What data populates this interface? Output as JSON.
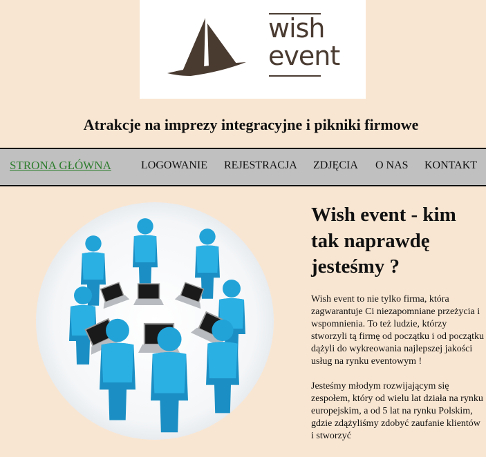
{
  "brand": {
    "logo_line1": "wish",
    "logo_line2": "event"
  },
  "tagline": "Atrakcje na imprezy integracyjne i pikniki firmowe",
  "nav": {
    "items": [
      {
        "label": "STRONA GŁÓWNA",
        "active": true
      },
      {
        "label": "LOGOWANIE",
        "active": false
      },
      {
        "label": "REJESTRACJA",
        "active": false
      },
      {
        "label": "ZDJĘCIA",
        "active": false
      },
      {
        "label": "O NAS",
        "active": false
      },
      {
        "label": "KONTAKT",
        "active": false
      }
    ]
  },
  "about": {
    "title": "Wish event - kim tak naprawdę jesteśmy ?",
    "paragraphs": [
      "Wish event to nie tylko firma, która zagwarantuje Ci niezapomniane przeżycia i wspomnienia. To też ludzie, którzy stworzyli tą firmę od początku i od początku dążyli do wykreowania najlepszej jakości usług na rynku eventowym !",
      "Jesteśmy młodym rozwijającym się zespołem, który od wielu lat działa na rynku europejskim, a od 5 lat na rynku Polskim, gdzie zdążyliśmy zdobyć zaufanie klientów i stworzyć"
    ]
  },
  "colors": {
    "page_background": "#f9e6d2",
    "nav_background": "#c0c0c0",
    "active_link": "#2e7d2e",
    "logo_brown": "#4a3b31",
    "figure_blue": "#22a3d8"
  }
}
